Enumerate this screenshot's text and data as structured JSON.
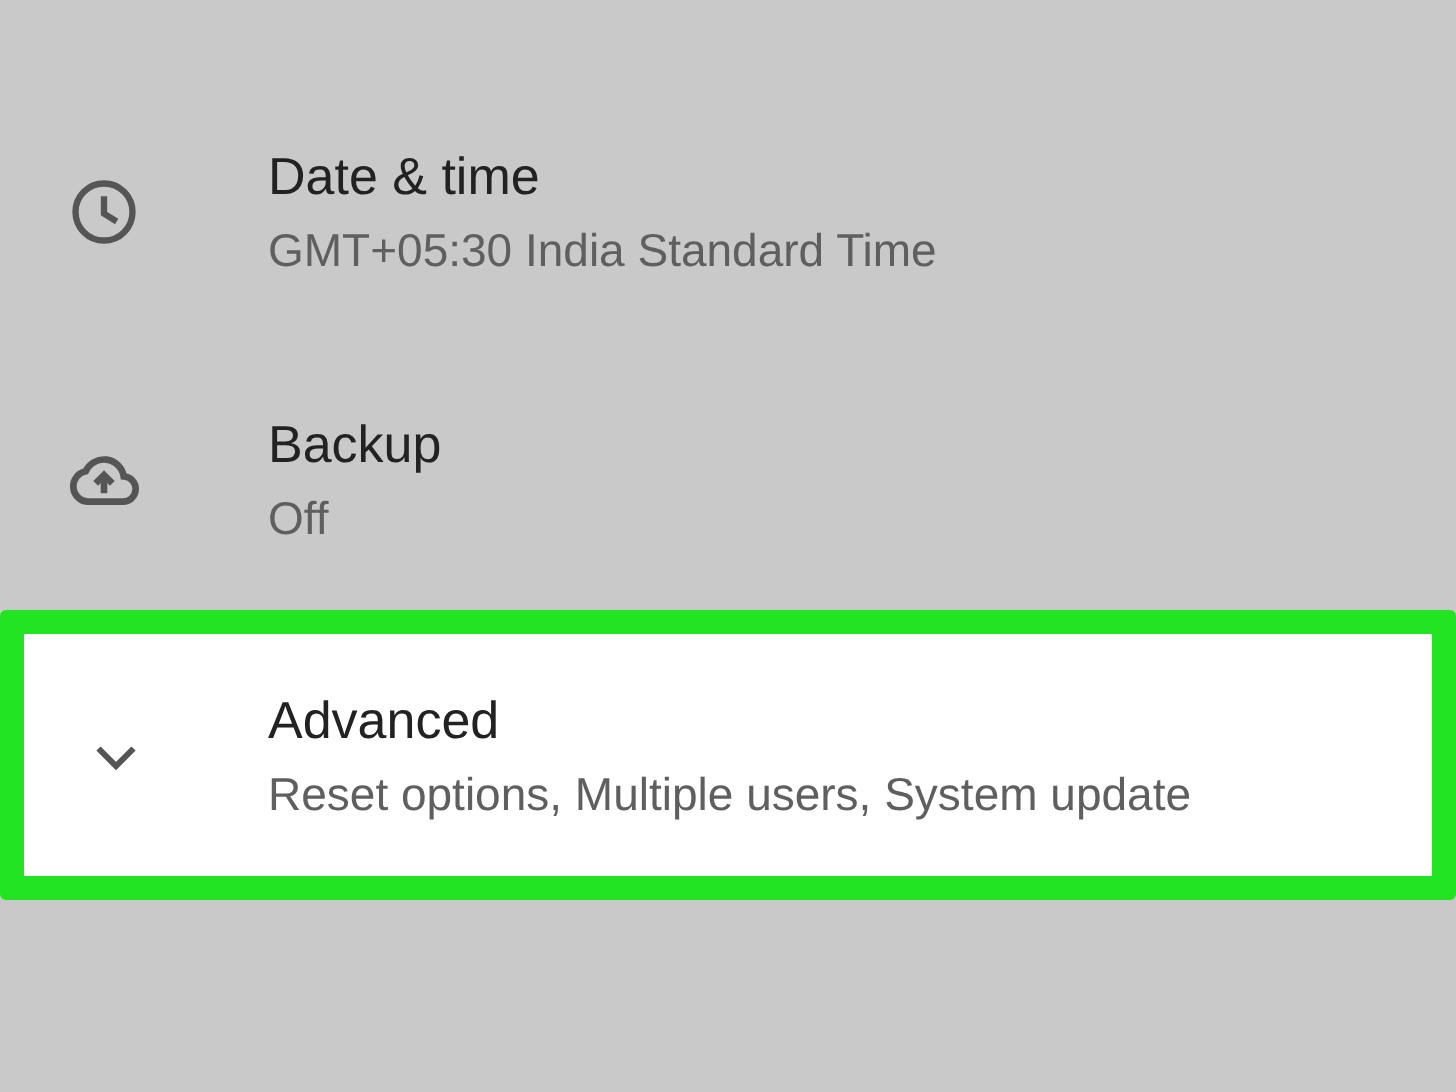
{
  "settings": [
    {
      "title": "Date & time",
      "subtitle": "GMT+05:30 India Standard Time",
      "highlighted": false
    },
    {
      "title": "Backup",
      "subtitle": "Off",
      "highlighted": false
    },
    {
      "title": "Advanced",
      "subtitle": "Reset options, Multiple users, System update",
      "highlighted": true,
      "expanded": false
    }
  ]
}
